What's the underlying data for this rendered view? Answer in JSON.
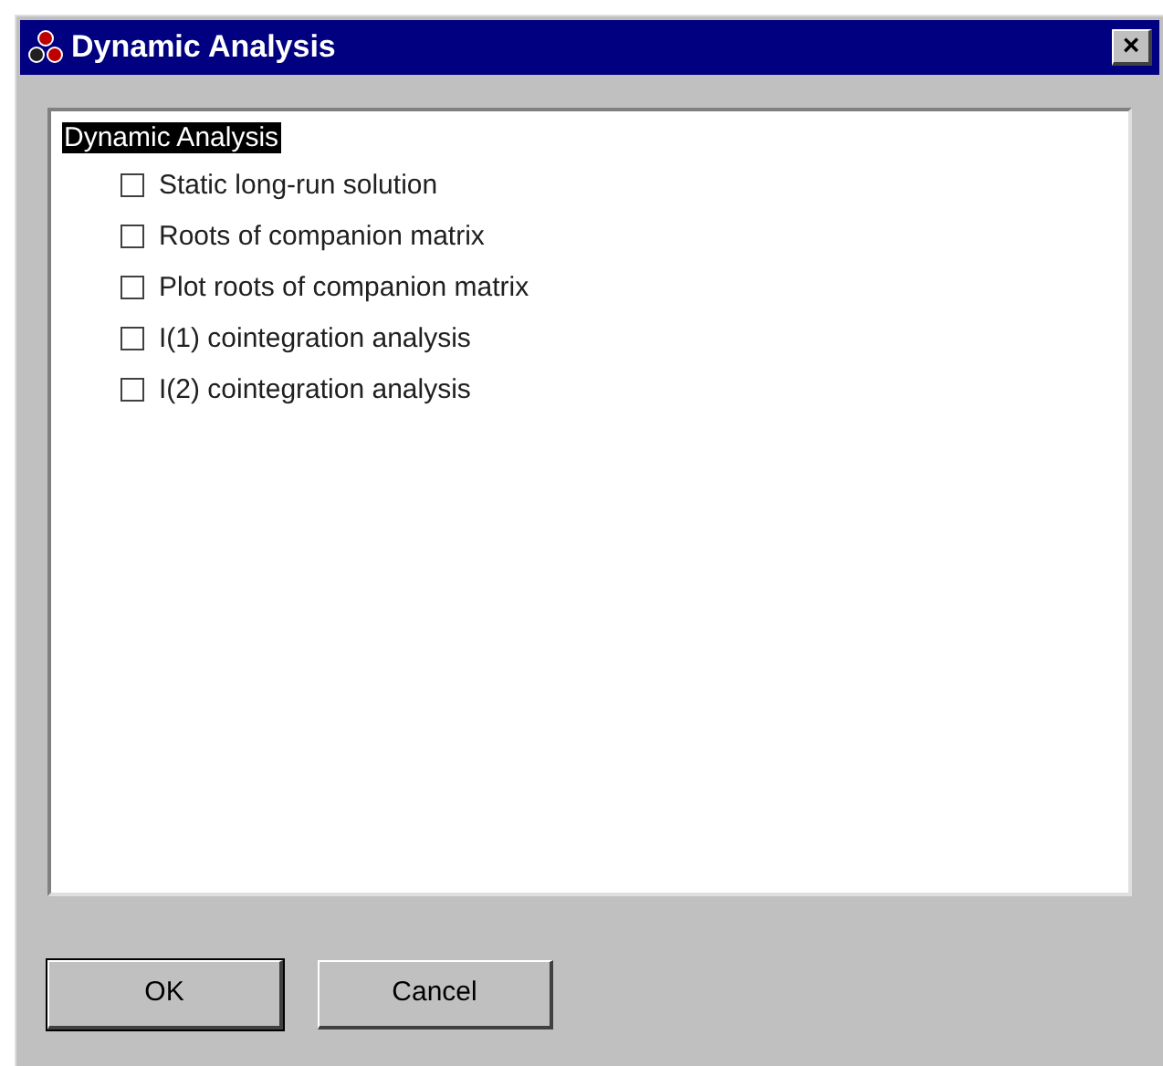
{
  "window": {
    "title": "Dynamic Analysis",
    "close": "×"
  },
  "tree": {
    "label": "Dynamic Analysis",
    "selected": true,
    "children": [
      {
        "label": "Static long-run solution",
        "checked": false
      },
      {
        "label": "Roots of companion matrix",
        "checked": false
      },
      {
        "label": "Plot roots of companion matrix",
        "checked": false
      },
      {
        "label": "I(1) cointegration analysis",
        "checked": false
      },
      {
        "label": "I(2) cointegration analysis",
        "checked": false
      }
    ]
  },
  "buttons": [
    {
      "label": "OK",
      "default": true
    },
    {
      "label": "Cancel",
      "default": false
    }
  ]
}
